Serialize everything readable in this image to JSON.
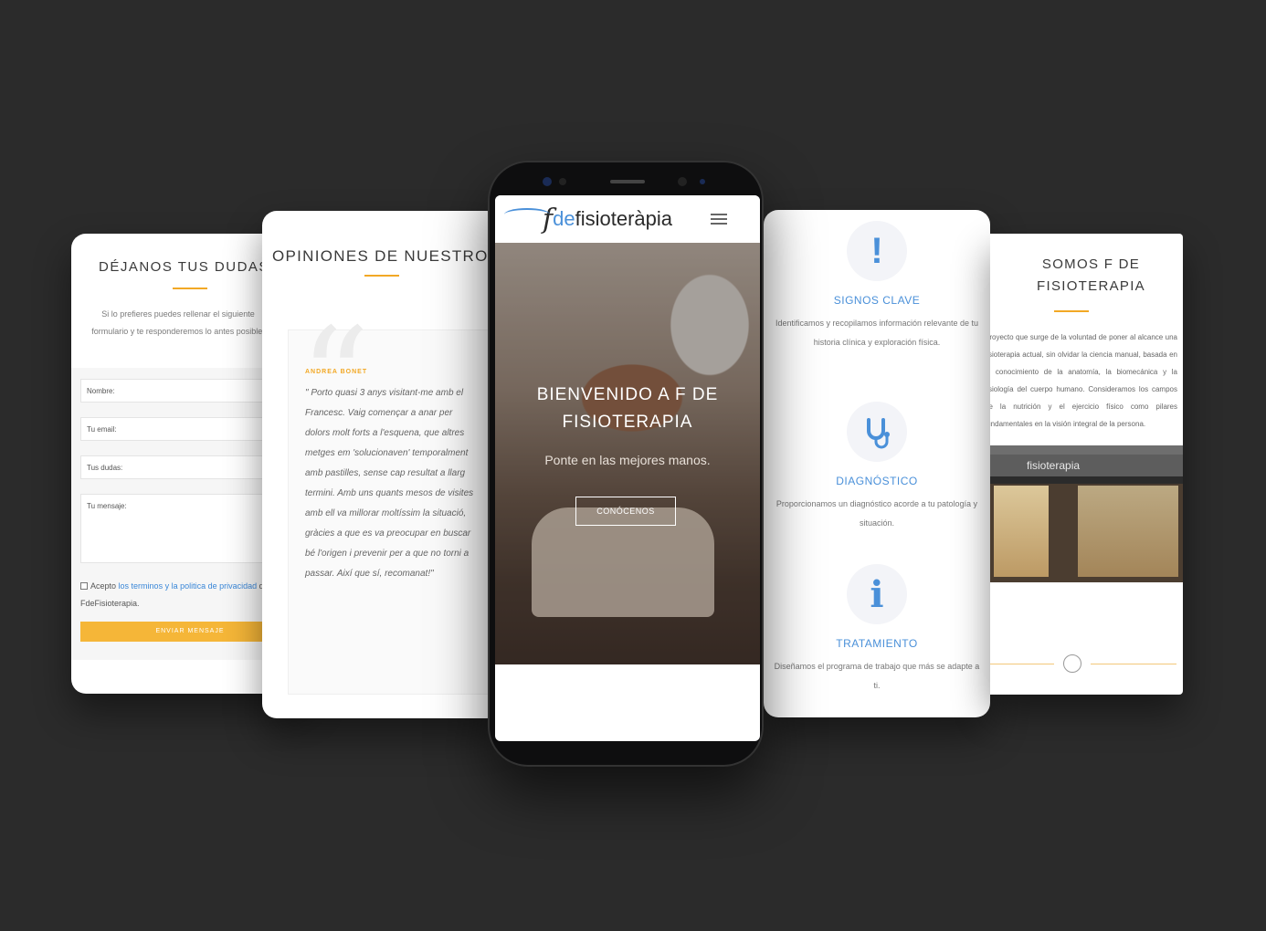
{
  "contact": {
    "title": "DÉJANOS TUS DUDAS",
    "intro": "Si lo prefieres puedes rellenar el siguiente formulario y te responderemos lo antes posible.",
    "fields": [
      "Nombre:",
      "Tu email:",
      "Tus dudas:",
      "Tu mensaje:"
    ],
    "consent_prefix": "Acepto",
    "consent_link": "los terminos y la politica de privacidad",
    "consent_suffix": "de FdeFisioterapia.",
    "send_label": "ENVIAR MENSAJE"
  },
  "opinions": {
    "title": "OPINIONES DE NUESTROS CLIENTES",
    "quote_mark": "“",
    "author": "ANDREA BONET",
    "quote": "\" Porto quasi 3 anys visitant-me amb el Francesc. Vaig començar a anar per dolors molt forts a l'esquena, que altres metges em 'solucionaven' temporalment amb pastilles, sense cap resultat a llarg termini. Amb uns quants mesos de visites amb ell va millorar moltíssim la situació, gràcies a que es va preocupar en buscar bé l'origen i prevenir per a que no torni a passar. Així que sí, recomanat!\""
  },
  "phone": {
    "logo_f": "f",
    "logo_de": "de",
    "logo_name": "fisioteràpia",
    "hero_title": "BIENVENIDO A F DE FISIOTERAPIA",
    "hero_subtitle": "Ponte en las mejores manos.",
    "hero_button": "CONÓCENOS"
  },
  "features": [
    {
      "icon": "exclamation-icon",
      "glyph": "!",
      "title": "SIGNOS CLAVE",
      "text": "Identificamos y recopilamos información relevante de tu historia clínica y exploración física."
    },
    {
      "icon": "stethoscope-icon",
      "glyph": "⚕",
      "title": "DIAGNÓSTICO",
      "text": "Proporcionamos un diagnóstico acorde a tu patología y situación."
    },
    {
      "icon": "info-icon",
      "glyph": "i",
      "title": "TRATAMIENTO",
      "text": "Diseñamos el programa de trabajo que más se adapte a ti."
    }
  ],
  "about": {
    "title": "SOMOS F DE FISIOTERAPIA",
    "text": "Proyecto que surge de la voluntad de poner al alcance una fisioterapia actual, sin olvidar la ciencia manual, basada en el conocimiento de la anatomía, la biomecánica y la fisiología del cuerpo humano. Consideramos los campos de la nutrición y el ejercicio físico como pilares fundamentales en la visión integral de la persona.",
    "sign": "fisioterapia"
  },
  "colors": {
    "accent": "#f2a825",
    "link": "#4a90d9",
    "background": "#2b2b2b"
  }
}
